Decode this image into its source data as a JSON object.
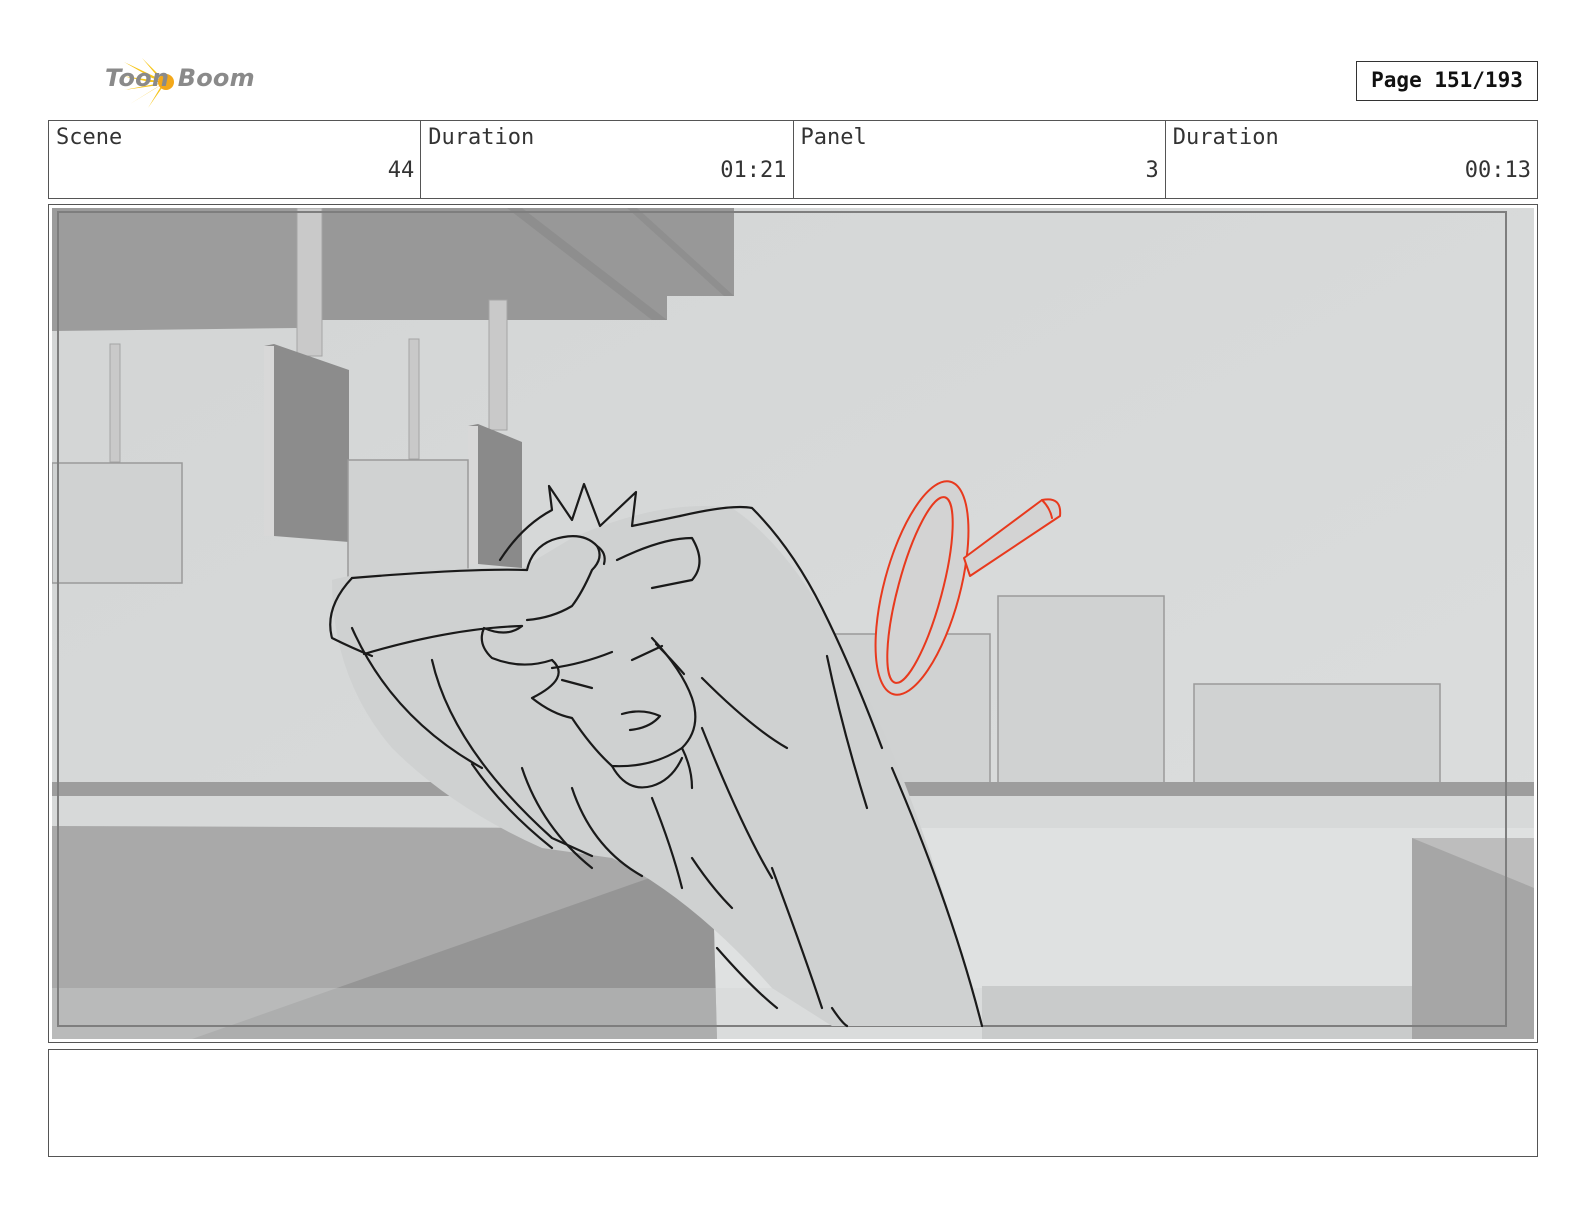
{
  "header": {
    "logo_text": "Toon Boom",
    "logo_icon": "starburst-logo-icon",
    "page_indicator": "Page 151/193"
  },
  "info": {
    "scene_label": "Scene",
    "scene_value": "44",
    "scene_duration_label": "Duration",
    "scene_duration_value": "01:21",
    "panel_label": "Panel",
    "panel_value": "3",
    "panel_duration_label": "Duration",
    "panel_duration_value": "00:13"
  },
  "colors": {
    "sketch_line": "#1a1a1a",
    "accent_sketch": "#e8391d",
    "background_gray": "#d4d6d6",
    "logo_yellow": "#f6c518"
  },
  "notes": {
    "text": ""
  }
}
